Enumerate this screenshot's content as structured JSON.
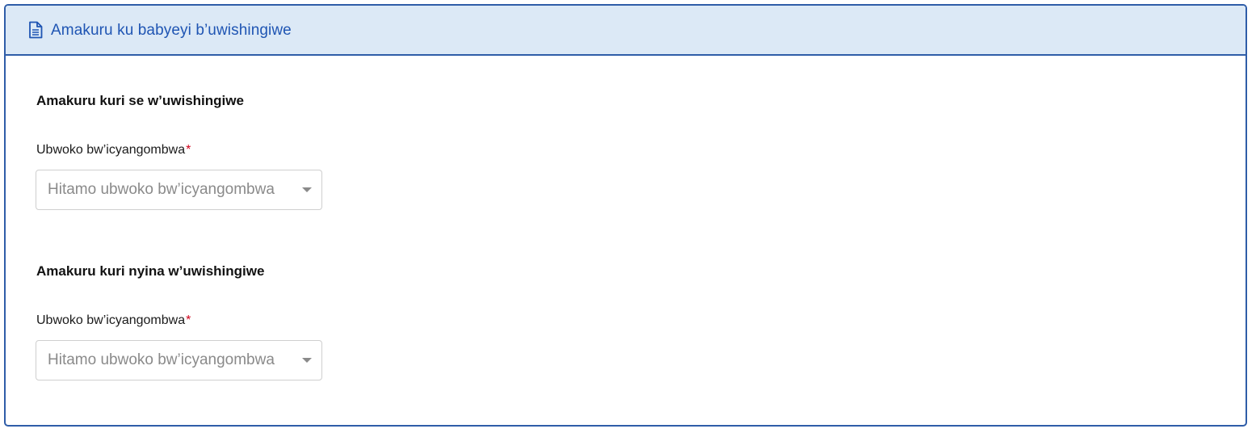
{
  "card": {
    "title": "Amakuru ku babyeyi b’uwishingiwe",
    "icon": "document-icon"
  },
  "sections": [
    {
      "title": "Amakuru kuri se w’uwishingiwe",
      "field_label": "Ubwoko bw’icyangombwa",
      "required_mark": "*",
      "select_placeholder": "Hitamo ubwoko bw’icyangombwa"
    },
    {
      "title": "Amakuru kuri nyina w’uwishingiwe",
      "field_label": "Ubwoko bw’icyangombwa",
      "required_mark": "*",
      "select_placeholder": "Hitamo ubwoko bw’icyangombwa"
    }
  ],
  "colors": {
    "accent": "#2f5da8",
    "header_bg": "#dce9f6",
    "title_text": "#1f55b3",
    "required": "#d0021b",
    "placeholder": "#8a8a8a"
  }
}
